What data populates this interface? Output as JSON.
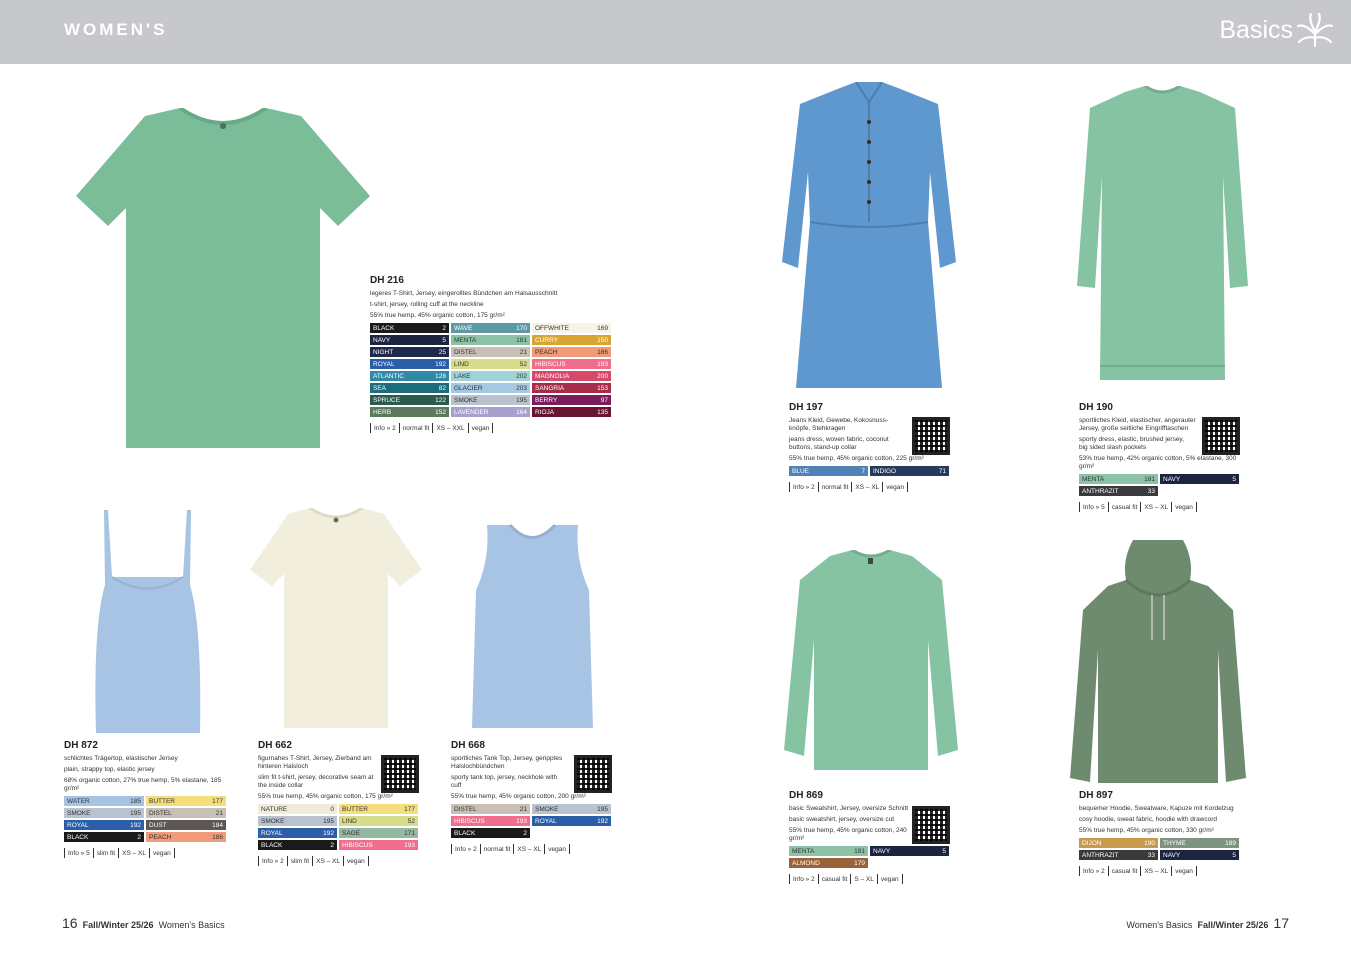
{
  "header": {
    "section": "WOMEN'S",
    "right_title": "Basics"
  },
  "colors": {
    "band": "#c6c8cb",
    "garment_green": "#7bbd98",
    "garment_blue": "#a8c4e4",
    "garment_cream": "#f2eedd",
    "garment_denim": "#5f97cf",
    "garment_olive": "#6f8b6f"
  },
  "products": {
    "dh216": {
      "code": "DH 216",
      "desc_de": "legeres T-Shirt, Jersey, eingerolltes Bündchen am Halsausschnitt",
      "desc_en": "t-shirt, jersey, rolling cuff at the neckline",
      "material": "55% true hemp, 45% organic cotton, 175 gr/m²",
      "swatches": [
        {
          "name": "BLACK",
          "num": "2",
          "bg": "#1a1a1a"
        },
        {
          "name": "WAVE",
          "num": "170",
          "bg": "#5c9aa8"
        },
        {
          "name": "OFFWHITE",
          "num": "169",
          "bg": "#f7f3e6"
        },
        {
          "name": "NAVY",
          "num": "5",
          "bg": "#1b2440"
        },
        {
          "name": "MENTA",
          "num": "181",
          "bg": "#8cc3a6"
        },
        {
          "name": "CURRY",
          "num": "150",
          "bg": "#d9a532"
        },
        {
          "name": "NIGHT",
          "num": "25",
          "bg": "#1e2a4a"
        },
        {
          "name": "DISTEL",
          "num": "21",
          "bg": "#c8c0b5"
        },
        {
          "name": "PEACH",
          "num": "186",
          "bg": "#f19a7a"
        },
        {
          "name": "ROYAL",
          "num": "192",
          "bg": "#2a5ea8"
        },
        {
          "name": "LIND",
          "num": "52",
          "bg": "#d6dc8a"
        },
        {
          "name": "HIBISCUS",
          "num": "193",
          "bg": "#ef6e8b"
        },
        {
          "name": "ATLANTIC",
          "num": "128",
          "bg": "#2f8aa8"
        },
        {
          "name": "LAKE",
          "num": "202",
          "bg": "#9fd3d6"
        },
        {
          "name": "MAGNOLIA",
          "num": "200",
          "bg": "#d54a6a"
        },
        {
          "name": "SEA",
          "num": "82",
          "bg": "#1d6b7e"
        },
        {
          "name": "GLACIER",
          "num": "203",
          "bg": "#a5c9e3"
        },
        {
          "name": "SANGRIA",
          "num": "153",
          "bg": "#a82c4a"
        },
        {
          "name": "SPRUCE",
          "num": "122",
          "bg": "#2a5a4c"
        },
        {
          "name": "SMOKE",
          "num": "195",
          "bg": "#b8c3cf"
        },
        {
          "name": "BERRY",
          "num": "97",
          "bg": "#7b1d5a"
        },
        {
          "name": "HERB",
          "num": "152",
          "bg": "#5d7a5e"
        },
        {
          "name": "LAVENDER",
          "num": "164",
          "bg": "#a7a1cf"
        },
        {
          "name": "RIOJA",
          "num": "135",
          "bg": "#6a1432"
        }
      ],
      "info": [
        "Info » 2",
        "normal fit",
        "XS – XXL",
        "vegan"
      ]
    },
    "dh872": {
      "code": "DH 872",
      "desc_de": "schlichtes Trägertop, elastischer Jersey",
      "desc_en": "plain, strappy top, elastic jersey",
      "material": "68% organic cotton, 27% true hemp, 5% elastane, 185 gr/m²",
      "swatches": [
        {
          "name": "WATER",
          "num": "185",
          "bg": "#a6c3e4"
        },
        {
          "name": "BUTTER",
          "num": "177",
          "bg": "#f3dd7c"
        },
        {
          "name": "SMOKE",
          "num": "195",
          "bg": "#b8c3cf"
        },
        {
          "name": "DISTEL",
          "num": "21",
          "bg": "#c8c0b5"
        },
        {
          "name": "ROYAL",
          "num": "192",
          "bg": "#2a5ea8"
        },
        {
          "name": "DUST",
          "num": "184",
          "bg": "#5e5753"
        },
        {
          "name": "BLACK",
          "num": "2",
          "bg": "#1a1a1a"
        },
        {
          "name": "PEACH",
          "num": "186",
          "bg": "#f19a7a"
        }
      ],
      "info": [
        "Info » 5",
        "slim fit",
        "XS – XL",
        "vegan"
      ]
    },
    "dh662": {
      "code": "DH 662",
      "desc_de": "figurnahes T-Shirt, Jersey, Zierband am hinteren Halsloch",
      "desc_en": "slim fit t-shirt, jersey, decorative seam at the inside collar",
      "material": "55% true hemp, 45% organic cotton, 175 gr/m²",
      "swatches": [
        {
          "name": "NATURE",
          "num": "0",
          "bg": "#f1ecd9"
        },
        {
          "name": "BUTTER",
          "num": "177",
          "bg": "#f3dd7c"
        },
        {
          "name": "SMOKE",
          "num": "195",
          "bg": "#b8c3cf"
        },
        {
          "name": "LIND",
          "num": "52",
          "bg": "#d6dc8a"
        },
        {
          "name": "ROYAL",
          "num": "192",
          "bg": "#2a5ea8"
        },
        {
          "name": "SAGE",
          "num": "171",
          "bg": "#93b9a0"
        },
        {
          "name": "BLACK",
          "num": "2",
          "bg": "#1a1a1a"
        },
        {
          "name": "HIBISCUS",
          "num": "193",
          "bg": "#ef6e8b"
        }
      ],
      "info": [
        "Info » 2",
        "slim fit",
        "XS – XL",
        "vegan"
      ]
    },
    "dh668": {
      "code": "DH 668",
      "desc_de": "sportliches Tank Top, Jersey, geripptes Halslochbündchen",
      "desc_en": "sporty tank top, jersey, neckhole with cuff",
      "material": "55% true hemp, 45% organic cotton, 200 gr/m²",
      "swatches": [
        {
          "name": "DISTEL",
          "num": "21",
          "bg": "#c8c0b5"
        },
        {
          "name": "SMOKE",
          "num": "195",
          "bg": "#b8c3cf"
        },
        {
          "name": "HIBISCUS",
          "num": "193",
          "bg": "#ef6e8b"
        },
        {
          "name": "ROYAL",
          "num": "192",
          "bg": "#2a5ea8"
        },
        {
          "name": "BLACK",
          "num": "2",
          "bg": "#1a1a1a"
        }
      ],
      "info": [
        "Info » 2",
        "normal fit",
        "XS – XL",
        "vegan"
      ]
    },
    "dh197": {
      "code": "DH 197",
      "desc_de": "Jeans Kleid, Gewebe, Kokosnuss-knöpfe, Stehkragen",
      "desc_en": "jeans dress, woven fabric, coconut buttons, stand-up collar",
      "material": "55% true hemp, 45% organic cotton, 225 gr/m²",
      "swatches": [
        {
          "name": "BLUE",
          "num": "7",
          "bg": "#4f82b5"
        },
        {
          "name": "INDIGO",
          "num": "71",
          "bg": "#253a5c"
        }
      ],
      "info": [
        "Info » 2",
        "normal fit",
        "XS – XL",
        "vegan"
      ]
    },
    "dh190": {
      "code": "DH 190",
      "desc_de": "sportliches Kleid, elastischer, angerauter Jersey, große seitliche Eingrifftaschen",
      "desc_en": "sporty dress, elastic, brushed jersey, big sided slash pockets",
      "material": "53% true hemp, 42% organic cotton, 5% elastane, 300 gr/m²",
      "swatches": [
        {
          "name": "MENTA",
          "num": "181",
          "bg": "#8cc3a6"
        },
        {
          "name": "NAVY",
          "num": "5",
          "bg": "#1b2440"
        },
        {
          "name": "ANTHRAZIT",
          "num": "33",
          "bg": "#3a3a3c"
        }
      ],
      "info": [
        "Info » 5",
        "casual fit",
        "XS – XL",
        "vegan"
      ]
    },
    "dh869": {
      "code": "DH 869",
      "desc_de": "basic Sweatshirt, Jersey, oversize Schnitt",
      "desc_en": "basic sweatshirt, jersey, oversize cut",
      "material": "55% true hemp, 45% organic cotton, 240 gr/m²",
      "swatches": [
        {
          "name": "MENTA",
          "num": "181",
          "bg": "#8cc3a6"
        },
        {
          "name": "NAVY",
          "num": "5",
          "bg": "#1b2440"
        },
        {
          "name": "ALMOND",
          "num": "179",
          "bg": "#9a6238"
        }
      ],
      "info": [
        "Info » 2",
        "casual fit",
        "S – XL",
        "vegan"
      ]
    },
    "dh897": {
      "code": "DH 897",
      "desc_de": "bequemer Hoodie, Sweatware, Kapuze mit Kordelzug",
      "desc_en": "cosy hoodie, sweat fabric, hoodie with drawcord",
      "material": "55% true hemp, 45% organic cotton, 330 gr/m²",
      "swatches": [
        {
          "name": "DIJON",
          "num": "190",
          "bg": "#c99a4c"
        },
        {
          "name": "THYME",
          "num": "189",
          "bg": "#7f9480"
        },
        {
          "name": "ANTHRAZIT",
          "num": "33",
          "bg": "#3a3a3c"
        },
        {
          "name": "NAVY",
          "num": "5",
          "bg": "#1b2440"
        }
      ],
      "info": [
        "Info » 2",
        "casual fit",
        "XS – XL",
        "vegan"
      ]
    }
  },
  "footer": {
    "left_page": "16",
    "left_season": "Fall/Winter 25/26",
    "left_section": "Women's Basics",
    "right_section": "Women's Basics",
    "right_season": "Fall/Winter 25/26",
    "right_page": "17"
  }
}
